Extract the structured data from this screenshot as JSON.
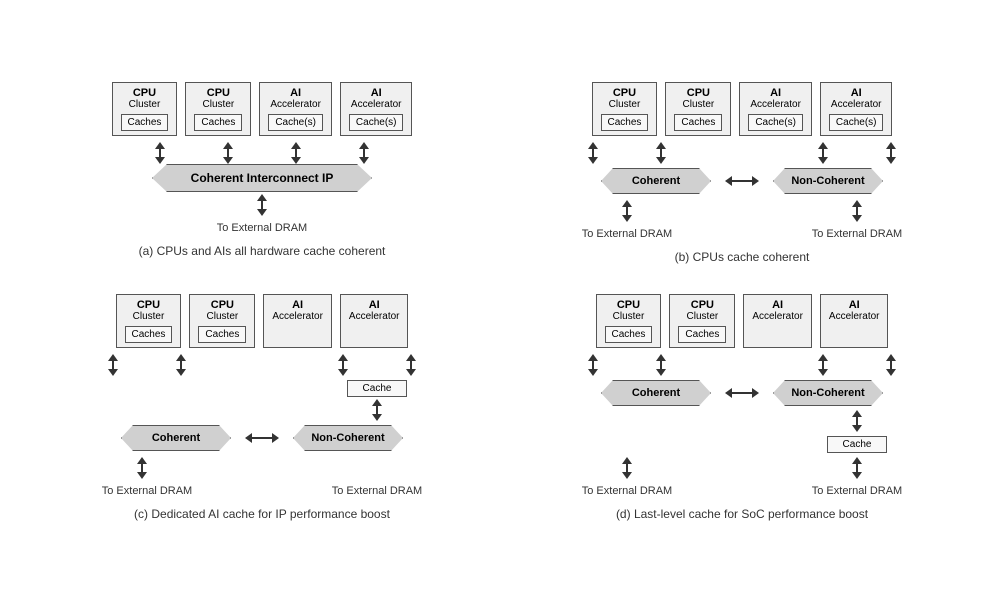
{
  "diagrams": {
    "a": {
      "caption": "(a) CPUs and AIs all hardware cache coherent",
      "nodes": [
        {
          "title": "CPU",
          "subtitle": "Cluster",
          "cache": "Caches"
        },
        {
          "title": "CPU",
          "subtitle": "Cluster",
          "cache": "Caches"
        },
        {
          "title": "AI",
          "subtitle": "Accelerator",
          "cache": "Cache(s)"
        },
        {
          "title": "AI",
          "subtitle": "Accelerator",
          "cache": "Cache(s)"
        }
      ],
      "banner": "Coherent Interconnect IP",
      "dram": [
        "To External DRAM"
      ]
    },
    "b": {
      "caption": "(b) CPUs cache coherent",
      "nodes": [
        {
          "title": "CPU",
          "subtitle": "Cluster",
          "cache": "Caches"
        },
        {
          "title": "CPU",
          "subtitle": "Cluster",
          "cache": "Caches"
        },
        {
          "title": "AI",
          "subtitle": "Accelerator",
          "cache": "Cache(s)"
        },
        {
          "title": "AI",
          "subtitle": "Accelerator",
          "cache": "Cache(s)"
        }
      ],
      "banners": [
        "Coherent",
        "Non-Coherent"
      ],
      "dram": [
        "To External DRAM",
        "To External DRAM"
      ]
    },
    "c": {
      "caption": "(c) Dedicated AI cache for IP performance boost",
      "nodes": [
        {
          "title": "CPU",
          "subtitle": "Cluster",
          "cache": "Caches"
        },
        {
          "title": "CPU",
          "subtitle": "Cluster",
          "cache": "Caches"
        },
        {
          "title": "AI",
          "subtitle": "Accelerator",
          "cache": null
        },
        {
          "title": "AI",
          "subtitle": "Accelerator",
          "cache": null
        }
      ],
      "ai_cache": "Cache",
      "banners": [
        "Coherent",
        "Non-Coherent"
      ],
      "dram": [
        "To External DRAM",
        "To External DRAM"
      ]
    },
    "d": {
      "caption": "(d) Last-level cache for SoC performance boost",
      "nodes": [
        {
          "title": "CPU",
          "subtitle": "Cluster",
          "cache": "Caches"
        },
        {
          "title": "CPU",
          "subtitle": "Cluster",
          "cache": "Caches"
        },
        {
          "title": "AI",
          "subtitle": "Accelerator",
          "cache": null
        },
        {
          "title": "AI",
          "subtitle": "Accelerator",
          "cache": null
        }
      ],
      "llc": "Cache",
      "banners": [
        "Coherent",
        "Non-Coherent"
      ],
      "dram": [
        "To External DRAM",
        "To External DRAM"
      ]
    }
  }
}
